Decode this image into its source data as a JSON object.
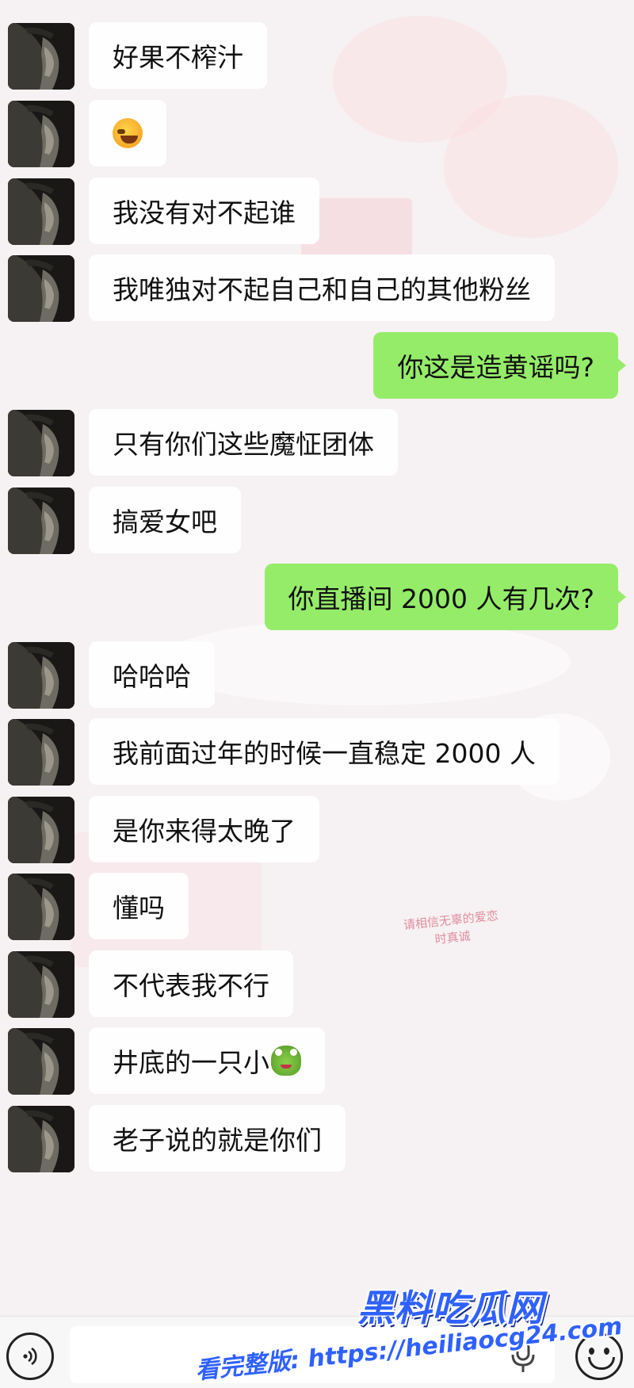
{
  "messages": [
    {
      "side": "left",
      "text": "好果不榨汁"
    },
    {
      "side": "left",
      "text": "",
      "emoji": "laughing-crying-emoji"
    },
    {
      "side": "left",
      "text": "我没有对不起谁"
    },
    {
      "side": "left",
      "text": "我唯独对不起自己和自己的其他粉丝"
    },
    {
      "side": "right",
      "text": "你这是造黄谣吗?"
    },
    {
      "side": "left",
      "text": "只有你们这些魔怔团体"
    },
    {
      "side": "left",
      "text": "搞爱女吧"
    },
    {
      "side": "right",
      "text": "你直播间 2000 人有几次?"
    },
    {
      "side": "left",
      "text": "哈哈哈"
    },
    {
      "side": "left",
      "text": "我前面过年的时候一直稳定 2000 人"
    },
    {
      "side": "left",
      "text": "是你来得太晚了"
    },
    {
      "side": "left",
      "text": "懂吗"
    },
    {
      "side": "left",
      "text": "不代表我不行"
    },
    {
      "side": "left",
      "text": "井底的一只小",
      "emoji": "frog-emoji"
    },
    {
      "side": "left",
      "text": "老子说的就是你们"
    }
  ],
  "background_note": {
    "line1": "请相信无辜的爱恋",
    "line2": "时真诚"
  },
  "watermark": {
    "line1": "黑料吃瓜网",
    "line2": "看完整版: https://heiliaocg24.com"
  },
  "colors": {
    "my_bubble": "#95ec69",
    "their_bubble": "#fefefe",
    "watermark": "#2f61ff"
  },
  "icons": {
    "voice": "voice-input-icon",
    "mic": "microphone-icon",
    "emoji": "emoji-smile-icon"
  }
}
